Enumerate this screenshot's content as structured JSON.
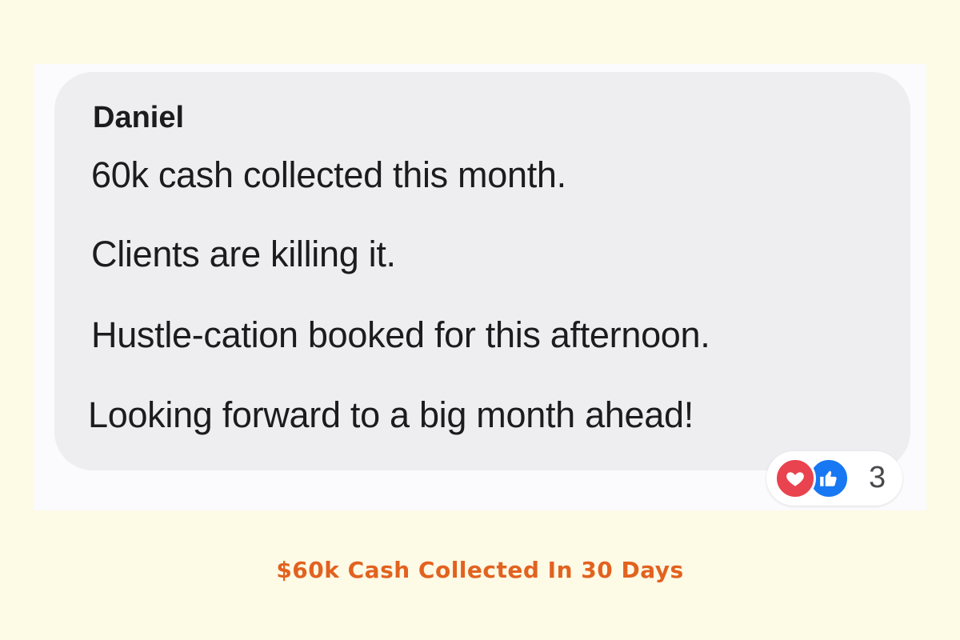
{
  "message": {
    "author": "Daniel",
    "lines": [
      "60k cash collected this month.",
      "Clients are killing it.",
      "Hustle-cation booked for this afternoon.",
      "Looking forward to a big month ahead!"
    ]
  },
  "reactions": {
    "icons": [
      "heart-icon",
      "thumbs-up-icon"
    ],
    "count": "3",
    "colors": {
      "heart": "#e9434f",
      "like": "#1877f2"
    }
  },
  "caption": "$60k Cash Collected In 30 Days",
  "colors": {
    "background": "#fdfae6",
    "bubble": "#eeeef1",
    "caption": "#e2621f"
  }
}
